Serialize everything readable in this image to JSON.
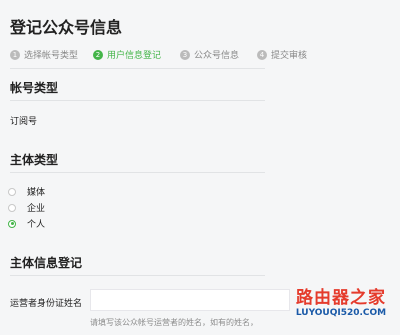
{
  "page": {
    "title": "登记公众号信息"
  },
  "steps": [
    {
      "num": "1",
      "label": "选择帐号类型"
    },
    {
      "num": "2",
      "label": "用户信息登记"
    },
    {
      "num": "3",
      "label": "公众号信息"
    },
    {
      "num": "4",
      "label": "提交审核"
    }
  ],
  "active_step": 2,
  "account_type": {
    "title": "帐号类型",
    "value": "订阅号"
  },
  "subject_type": {
    "title": "主体类型",
    "options": [
      "媒体",
      "企业",
      "个人"
    ],
    "selected": "个人"
  },
  "subject_info": {
    "title": "主体信息登记",
    "operator_name_label": "运营者身份证姓名",
    "operator_name_value": "",
    "operator_name_hint": "请填写该公众帐号运营者的姓名，如有的姓名，"
  },
  "watermark": {
    "main": "路由器之家",
    "sub": "LUYOUQI520.COM"
  },
  "colors": {
    "accent": "#44b549",
    "background": "#f5f6f7",
    "watermark_red": "#e53b2c",
    "watermark_blue": "#1a5aa8"
  }
}
